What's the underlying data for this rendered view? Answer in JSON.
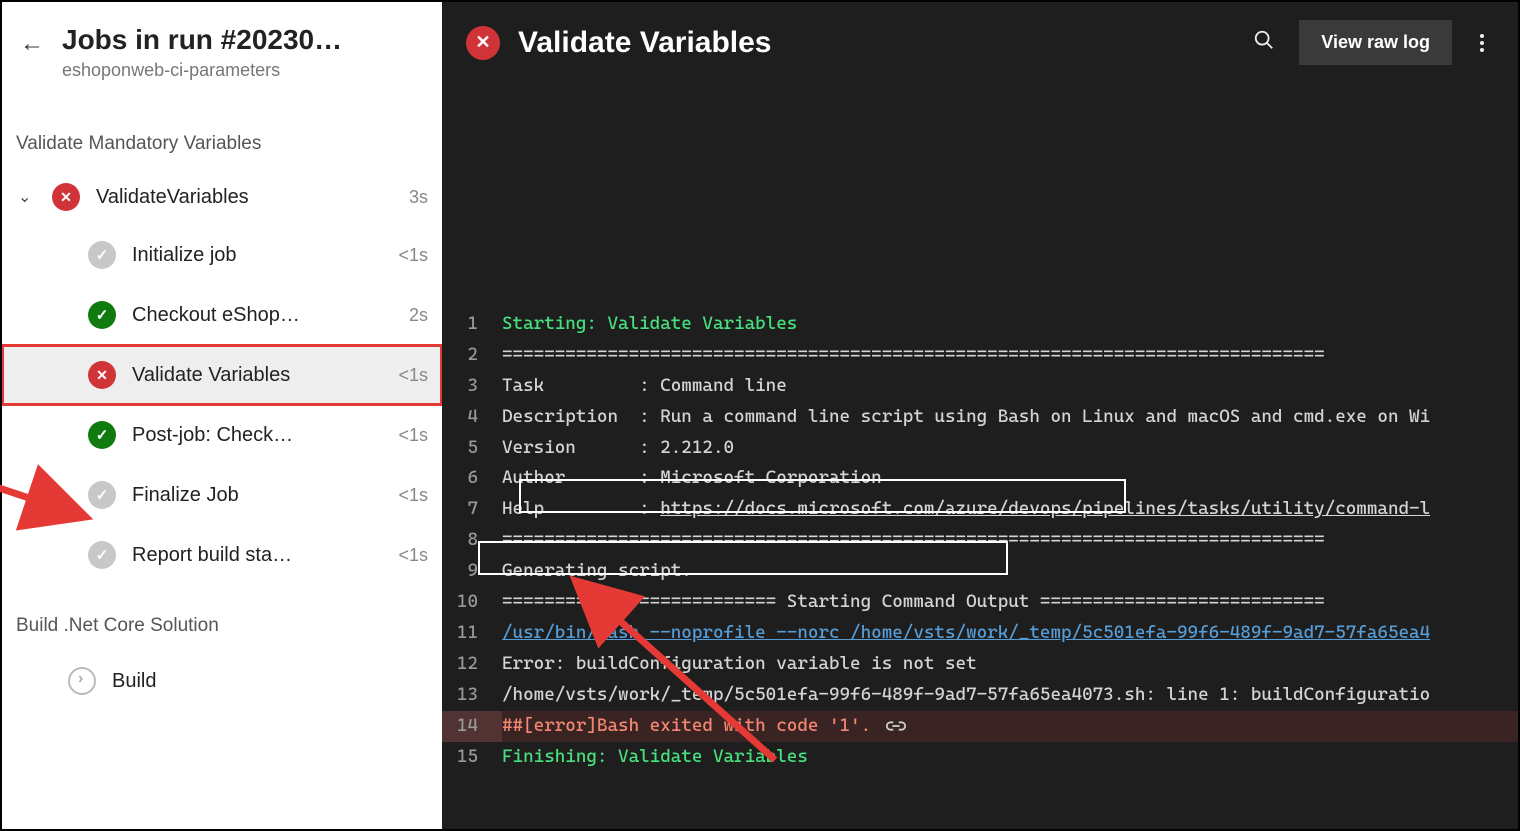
{
  "sidebar": {
    "back_icon": "←",
    "title": "Jobs in run #20230…",
    "subtitle": "eshoponweb-ci-parameters",
    "stage1_label": "Validate Mandatory Variables",
    "job": {
      "label": "ValidateVariables",
      "duration": "3s"
    },
    "steps": [
      {
        "label": "Initialize job",
        "duration": "<1s",
        "status": "grey"
      },
      {
        "label": "Checkout eShop…",
        "duration": "2s",
        "status": "ok"
      },
      {
        "label": "Validate Variables",
        "duration": "<1s",
        "status": "fail",
        "selected": true
      },
      {
        "label": "Post-job: Check…",
        "duration": "<1s",
        "status": "ok"
      },
      {
        "label": "Finalize Job",
        "duration": "<1s",
        "status": "grey"
      },
      {
        "label": "Report build sta…",
        "duration": "<1s",
        "status": "grey"
      }
    ],
    "stage2_label": "Build .Net Core Solution",
    "build_job_label": "Build"
  },
  "log": {
    "title": "Validate Variables",
    "raw_button": "View raw log",
    "lines": [
      {
        "n": 1,
        "cls": "green",
        "text": "Starting: Validate Variables"
      },
      {
        "n": 2,
        "cls": "",
        "text": "=============================================================================="
      },
      {
        "n": 3,
        "cls": "",
        "text": "Task         : Command line"
      },
      {
        "n": 4,
        "cls": "",
        "text": "Description  : Run a command line script using Bash on Linux and macOS and cmd.exe on Wi"
      },
      {
        "n": 5,
        "cls": "",
        "text": "Version      : 2.212.0"
      },
      {
        "n": 6,
        "cls": "",
        "text": "Author       : Microsoft Corporation"
      },
      {
        "n": 7,
        "cls": "link",
        "prefix": "Help         : ",
        "url": "https://docs.microsoft.com/azure/devops/pipelines/tasks/utility/command-l"
      },
      {
        "n": 8,
        "cls": "",
        "text": "=============================================================================="
      },
      {
        "n": 9,
        "cls": "",
        "text": "Generating script."
      },
      {
        "n": 10,
        "cls": "",
        "text": "========================== Starting Command Output ==========================="
      },
      {
        "n": 11,
        "cls": "blue",
        "text": "/usr/bin/bash --noprofile --norc /home/vsts/work/_temp/5c501efa-99f6-489f-9ad7-57fa65ea4"
      },
      {
        "n": 12,
        "cls": "",
        "text": "Error: buildConfiguration variable is not set"
      },
      {
        "n": 13,
        "cls": "",
        "text": "/home/vsts/work/_temp/5c501efa-99f6-489f-9ad7-57fa65ea4073.sh: line 1: buildConfiguratio"
      },
      {
        "n": 14,
        "cls": "red",
        "errbg": true,
        "text": "##[error]Bash exited with code '1'.",
        "link_icon": true
      },
      {
        "n": 15,
        "cls": "green",
        "text": "Finishing: Validate Variables"
      }
    ]
  }
}
